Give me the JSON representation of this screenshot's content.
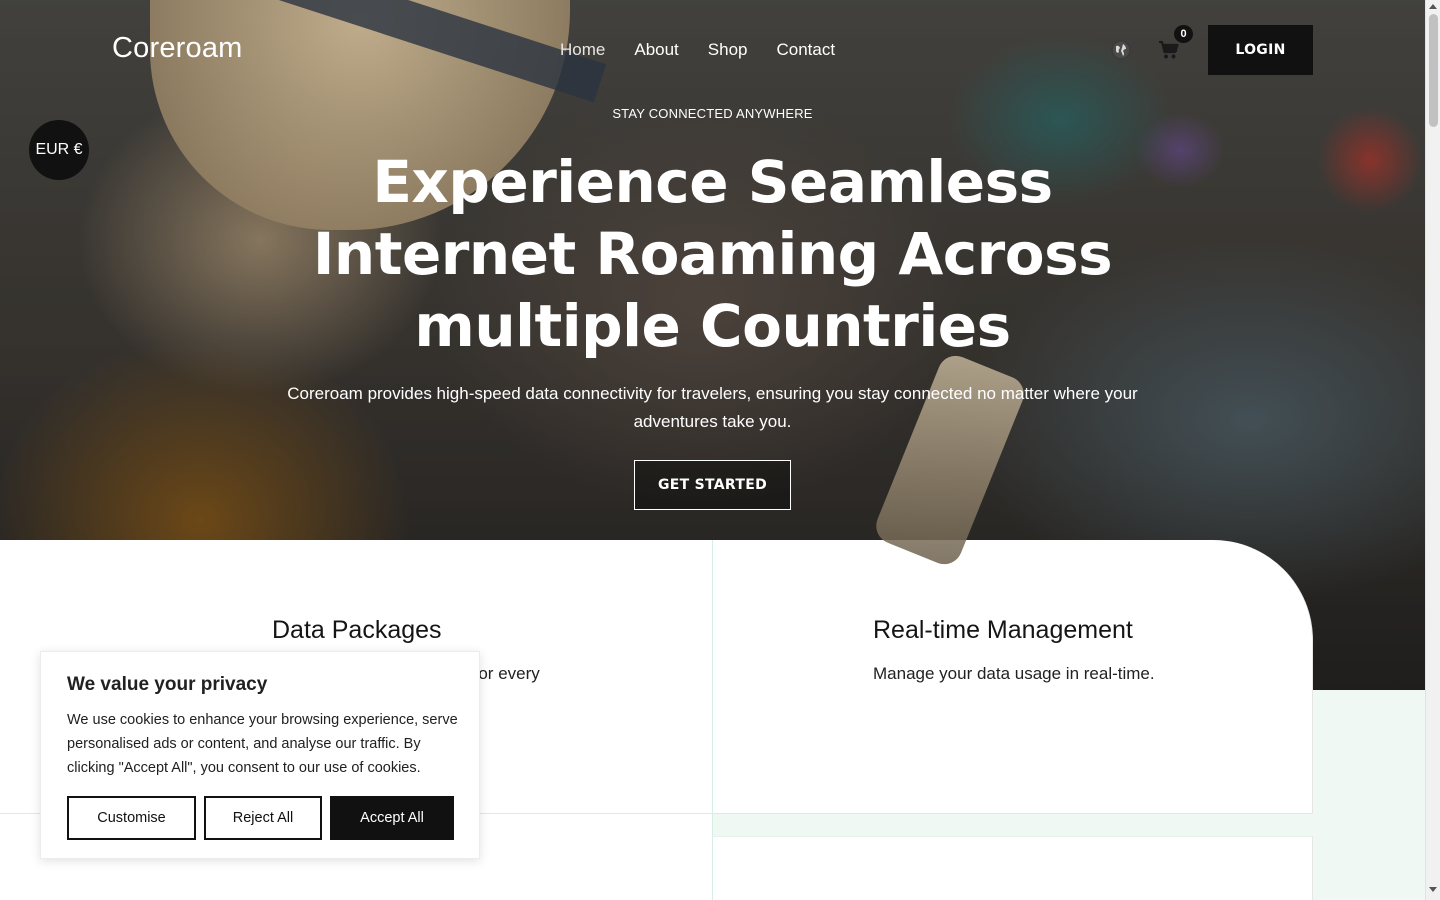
{
  "header": {
    "logo": "Coreroam",
    "nav": [
      "Home",
      "About",
      "Shop",
      "Contact"
    ],
    "cart_count": "0",
    "login_label": "LOGIN",
    "icons": [
      "globe-icon",
      "cart-icon"
    ]
  },
  "currency_label": "EUR €",
  "hero": {
    "eyebrow": "STAY CONNECTED ANYWHERE",
    "headline": "Experience Seamless Internet Roaming Across multiple Countries",
    "subtext": "Coreroam provides high-speed data connectivity for travelers, ensuring you stay connected no matter where your adventures take you.",
    "cta_label": "GET STARTED"
  },
  "features": [
    {
      "title": "Data Packages",
      "text": "ed for every"
    },
    {
      "title": "Real-time Management",
      "text": "Manage your data usage in real-time."
    }
  ],
  "cookie": {
    "title": "We value your privacy",
    "body": "We use cookies to enhance your browsing experience, serve personalised ads or content, and analyse our traffic. By clicking \"Accept All\", you consent to our use of cookies.",
    "customise_label": "Customise",
    "reject_label": "Reject All",
    "accept_label": "Accept All"
  },
  "colors": {
    "dark": "#111111",
    "mint": "#eff8f3",
    "border_mint": "#d6eee3"
  }
}
